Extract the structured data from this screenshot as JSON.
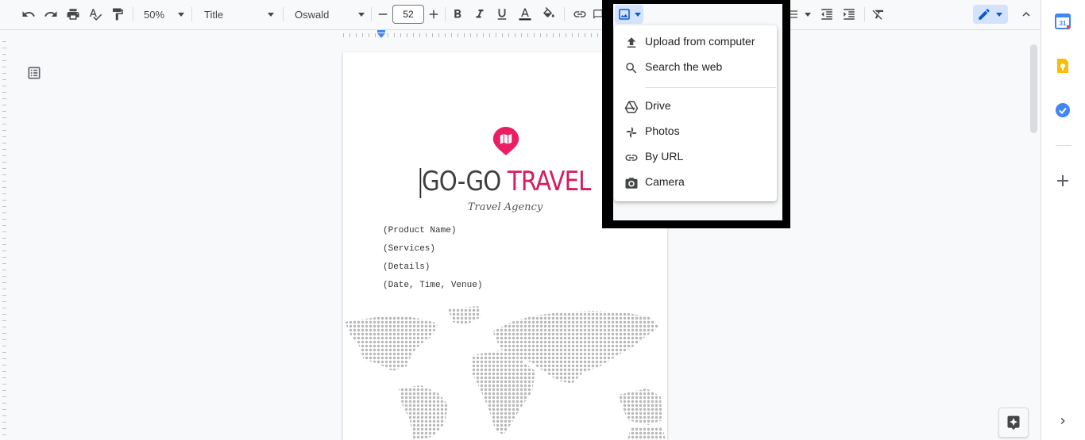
{
  "toolbar": {
    "zoom": "50%",
    "style": "Title",
    "font": "Oswald",
    "font_size": "52"
  },
  "document": {
    "title_part1": "GO-GO ",
    "title_part2": "TRAVEL",
    "subtitle": "Travel Agency",
    "fields": [
      "(Product Name)",
      "(Services)",
      "(Details)",
      "(Date, Time, Venue)"
    ],
    "accent_color": "#d81b60"
  },
  "insert_image_menu": {
    "items": [
      {
        "label": "Upload from computer",
        "icon": "upload-icon"
      },
      {
        "label": "Search the web",
        "icon": "search-icon"
      },
      {
        "label": "Drive",
        "icon": "drive-icon"
      },
      {
        "label": "Photos",
        "icon": "photos-icon"
      },
      {
        "label": "By URL",
        "icon": "link-icon"
      },
      {
        "label": "Camera",
        "icon": "camera-icon"
      }
    ]
  },
  "side_panel": {
    "icons": [
      "calendar-icon",
      "keep-icon",
      "tasks-icon",
      "add-icon"
    ],
    "calendar_day": "31"
  }
}
